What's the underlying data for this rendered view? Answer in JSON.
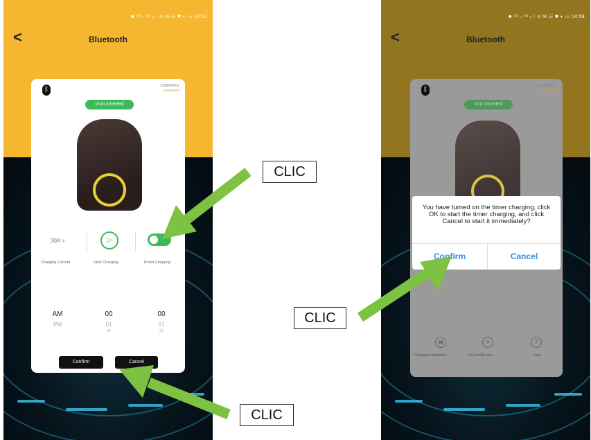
{
  "left_screen": {
    "status_bar": "■ ⁵ᴳ ᵢₗ ⁵ᴳ ᵢₗ ⁵ ⊙ ✉   ☷ ✱ ◐ ▭ 14:57",
    "back_symbol": "<",
    "title": "Bluetooth",
    "device_id": "2308800001",
    "device_status": "Connected",
    "gun_badge": "Gun Inserted",
    "current_value": "30A >",
    "label_current": "Charging Current",
    "label_start": "Start Charging",
    "label_timed": "Timed Charging",
    "picker": {
      "col1": [
        "AM",
        "PM"
      ],
      "col2": [
        "00",
        "01",
        "02"
      ],
      "col3": [
        "00",
        "01",
        "02"
      ]
    },
    "confirm_label": "Confirm",
    "cancel_label": "Cancel"
  },
  "right_screen": {
    "status_bar": "■ ⁵ᴳ ᵢₗ ⁵ᴳ ᵢₗ ⁵ ⊙ ✉   ☷ ✱ ◐ ▭ 14:58",
    "back_symbol": "<",
    "title": "Bluetooth",
    "device_id": "2308800001",
    "device_status": "Connected",
    "gun_badge": "Gun Inserted",
    "dialog_message": "You have turned on the timer charging, click OK to start the timer charging, and click Cancel to start it immediately?",
    "dialog_confirm": "Confirm",
    "dialog_cancel": "Cancel",
    "footer": [
      {
        "label": "Charging Information",
        "icon": "document-icon"
      },
      {
        "label": "Key Modification",
        "icon": "key-icon"
      },
      {
        "label": "Help",
        "icon": "help-icon"
      }
    ]
  },
  "callouts": {
    "c1": "CLIC",
    "c2": "CLIC",
    "c3": "CLIC"
  },
  "colors": {
    "topbar": "#f6b730",
    "accent_green": "#3dba5a",
    "arrow_green": "#7dc242",
    "dialog_link": "#3a8bd8"
  }
}
